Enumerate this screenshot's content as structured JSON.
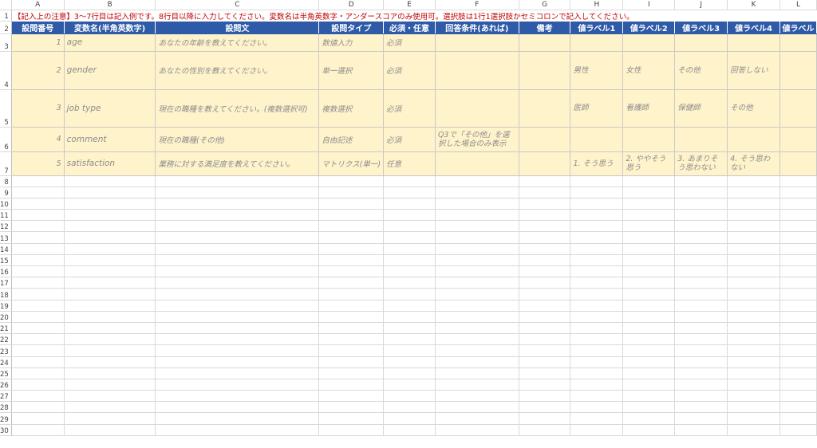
{
  "columns": [
    "A",
    "B",
    "C",
    "D",
    "E",
    "F",
    "G",
    "H",
    "I",
    "J",
    "K",
    "L"
  ],
  "rows": [
    "1",
    "2",
    "3",
    "4",
    "5",
    "6",
    "7",
    "8",
    "9",
    "10",
    "11",
    "12",
    "13",
    "14",
    "15",
    "16",
    "17",
    "18",
    "19",
    "20",
    "21",
    "22",
    "23",
    "24",
    "25",
    "26",
    "27",
    "28",
    "29",
    "30"
  ],
  "notice": "【記入上の注意】3～7行目は記入例です。8行目以降に入力してください。変数名は半角英数字・アンダースコアのみ使用可。選択肢は1行1選択肢かセミコロンで記入してください。",
  "headers": [
    "設問番号",
    "変数名(半角英数字)",
    "設問文",
    "設問タイプ",
    "必須・任意",
    "回答条件(あれば)",
    "備考",
    "値ラベル1",
    "値ラベル2",
    "値ラベル3",
    "値ラベル4",
    "値ラベル"
  ],
  "examples": [
    {
      "no": "1",
      "var": "age",
      "text": "あなたの年齢を教えてください。",
      "type": "数値入力",
      "req": "必須",
      "cond": "",
      "note": "",
      "l1": "",
      "l2": "",
      "l3": "",
      "l4": "",
      "l5": ""
    },
    {
      "no": "2",
      "var": "gender",
      "text": "あなたの性別を教えてください。",
      "type": "単一選択",
      "req": "必須",
      "cond": "",
      "note": "",
      "l1": "男性",
      "l2": "女性",
      "l3": "その他",
      "l4": "回答しない",
      "l5": ""
    },
    {
      "no": "3",
      "var": "job type",
      "text": "現在の職種を教えてください。(複数選択可)",
      "type": "複数選択",
      "req": "必須",
      "cond": "",
      "note": "",
      "l1": "医師",
      "l2": "看護師",
      "l3": "保健師",
      "l4": "その他",
      "l5": ""
    },
    {
      "no": "4",
      "var": "comment",
      "text": "現在の職種(その他)",
      "type": "自由記述",
      "req": "必須",
      "cond": "Q3で「その他」を選択した場合のみ表示",
      "note": "",
      "l1": "",
      "l2": "",
      "l3": "",
      "l4": "",
      "l5": ""
    },
    {
      "no": "5",
      "var": "satisfaction",
      "text": "業務に対する満足度を教えてください。",
      "type": "マトリクス(単一)",
      "req": "任意",
      "cond": "",
      "note": "",
      "l1": "1. そう思う",
      "l2": "2. ややそう思う",
      "l3": "3. あまりそう思わない",
      "l4": "4. そう思わない",
      "l5": ""
    }
  ]
}
